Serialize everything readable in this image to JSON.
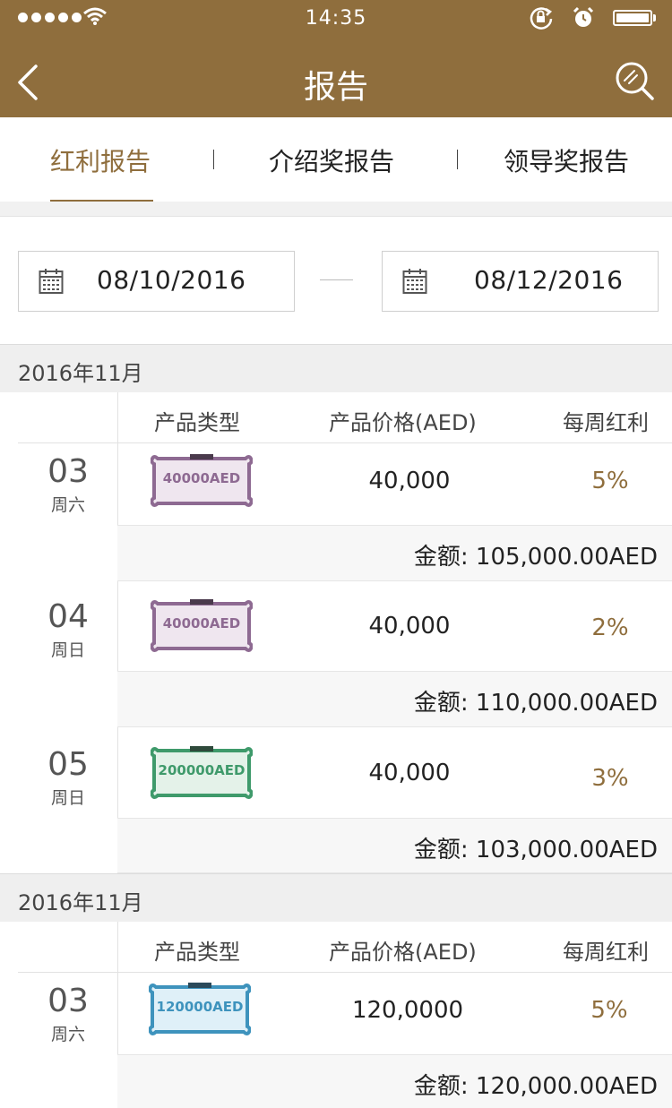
{
  "status_bar": {
    "time": "14:35"
  },
  "nav": {
    "title": "报告"
  },
  "tabs": [
    {
      "label": "红利报告",
      "active": true
    },
    {
      "label": "介绍奖报告",
      "active": false
    },
    {
      "label": "领导奖报告",
      "active": false
    }
  ],
  "date_range": {
    "start": "08/10/2016",
    "end": "08/12/2016"
  },
  "columns": {
    "product_type": "产品类型",
    "product_price": "产品价格(AED)",
    "weekly_dividend": "每周红利"
  },
  "sections": [
    {
      "month": "2016年11月",
      "rows": [
        {
          "day": "03",
          "weekday": "周六",
          "ticket": "40000AED",
          "ticket_color": "purple",
          "price": "40,000",
          "percent": "5%",
          "amount": "金额: 105,000.00AED"
        },
        {
          "day": "04",
          "weekday": "周日",
          "ticket": "40000AED",
          "ticket_color": "purple",
          "price": "40,000",
          "percent": "2%",
          "amount": "金额: 110,000.00AED"
        },
        {
          "day": "05",
          "weekday": "周日",
          "ticket": "200000AED",
          "ticket_color": "green",
          "price": "40,000",
          "percent": "3%",
          "amount": "金额: 103,000.00AED"
        }
      ]
    },
    {
      "month": "2016年11月",
      "rows": [
        {
          "day": "03",
          "weekday": "周六",
          "ticket": "120000AED",
          "ticket_color": "blue",
          "price": "120,0000",
          "percent": "5%",
          "amount": "金额: 120,000.00AED"
        }
      ]
    }
  ],
  "colors": {
    "brand": "#8f6e3d",
    "ticket_purple": "#8e6a92",
    "ticket_green": "#3f9a6b",
    "ticket_blue": "#3e93bd"
  },
  "icons": [
    "signal-dots-icon",
    "wifi-icon",
    "rotation-lock-icon",
    "alarm-icon",
    "battery-icon",
    "back-chevron-icon",
    "search-icon",
    "calendar-icon"
  ]
}
